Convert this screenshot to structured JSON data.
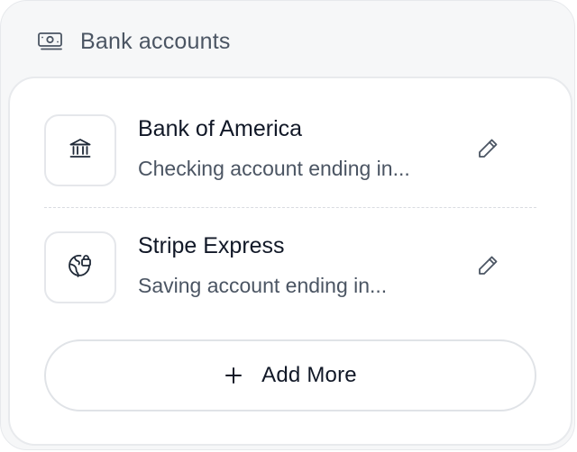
{
  "header": {
    "title": "Bank accounts",
    "icon": "banknote-icon"
  },
  "accounts": [
    {
      "name": "Bank of America",
      "description": "Checking account ending in...",
      "icon": "bank-building-icon"
    },
    {
      "name": "Stripe Express",
      "description": "Saving account ending in...",
      "icon": "globe-lock-icon"
    }
  ],
  "actions": {
    "add_more_label": "Add More",
    "edit_icon": "pencil-icon",
    "add_icon": "plus-icon"
  },
  "colors": {
    "panel_background": "#f6f7f8",
    "card_background": "#ffffff",
    "border": "#e8eaed",
    "primary_text": "#111827",
    "secondary_text": "#4b5563"
  }
}
